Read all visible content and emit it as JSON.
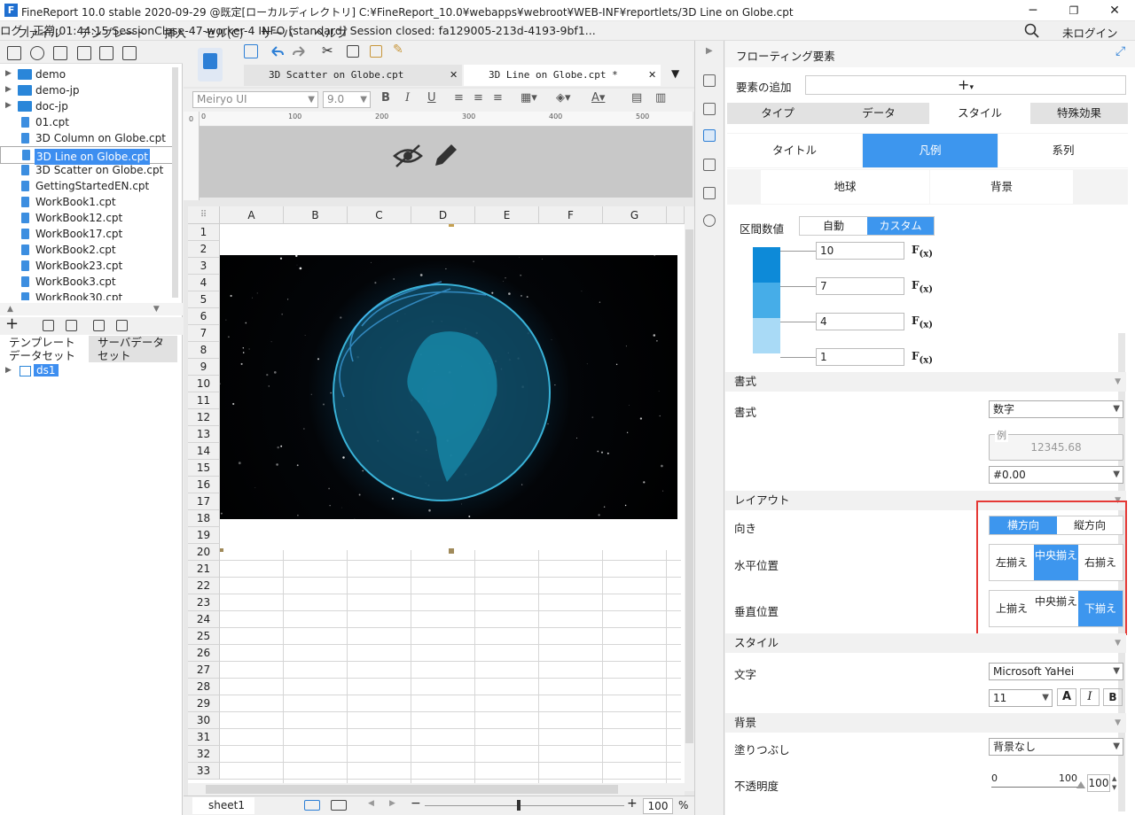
{
  "titlebar": {
    "logo": "F",
    "title": "FineReport 10.0 stable 2020-09-29 @既定[ローカルディレクトリ]    C:¥FineReport_10.0¥webapps¥webroot¥WEB-INF¥reportlets/3D Line on Globe.cpt",
    "minimize": "─",
    "restore": "❐",
    "close": "✕"
  },
  "menubar": {
    "items": [
      "ファイル",
      "テンプレート",
      "挿入",
      "セル(C)",
      "サーバ",
      "ヘルプ"
    ],
    "status": "ログ | 正常:01:44:15 SessionClose-47-worker-4 INFO [standard] Session closed: fa129005-213d-4193-9bf1...",
    "login": "未ログイン"
  },
  "filetree": {
    "items": [
      {
        "name": "demo",
        "kind": "folder"
      },
      {
        "name": "demo-jp",
        "kind": "folder"
      },
      {
        "name": "doc-jp",
        "kind": "folder"
      },
      {
        "name": "01.cpt",
        "kind": "file"
      },
      {
        "name": "3D Column on Globe.cpt",
        "kind": "file"
      },
      {
        "name": "3D Line on Globe.cpt",
        "kind": "file",
        "selected": true
      },
      {
        "name": "3D Scatter on Globe.cpt",
        "kind": "file"
      },
      {
        "name": "GettingStartedEN.cpt",
        "kind": "file"
      },
      {
        "name": "WorkBook1.cpt",
        "kind": "file"
      },
      {
        "name": "WorkBook12.cpt",
        "kind": "file"
      },
      {
        "name": "WorkBook17.cpt",
        "kind": "file"
      },
      {
        "name": "WorkBook2.cpt",
        "kind": "file"
      },
      {
        "name": "WorkBook23.cpt",
        "kind": "file"
      },
      {
        "name": "WorkBook3.cpt",
        "kind": "file"
      },
      {
        "name": "WorkBook30.cpt",
        "kind": "file"
      }
    ]
  },
  "dataset": {
    "tab1a": "テンプレート",
    "tab1b": "データセット",
    "tab2a": "サーバデータ",
    "tab2b": "セット",
    "ds": "ds1"
  },
  "editor": {
    "tabs": [
      "3D Scatter on Globe.cpt",
      "3D Line on Globe.cpt *"
    ],
    "font": "Meiryo UI",
    "size": "9.0",
    "ruler": [
      "0",
      "100",
      "200",
      "300",
      "400",
      "500"
    ],
    "columns": [
      "A",
      "B",
      "C",
      "D",
      "E",
      "F",
      "G"
    ],
    "rows": [
      "1",
      "2",
      "3",
      "4",
      "5",
      "6",
      "7",
      "8",
      "9",
      "10",
      "11",
      "12",
      "13",
      "14",
      "15",
      "16",
      "17",
      "18",
      "19",
      "20",
      "21",
      "22",
      "23",
      "24",
      "25",
      "26",
      "27",
      "28",
      "29",
      "30",
      "31",
      "32",
      "33"
    ],
    "sheet": "sheet1",
    "zoom": "100",
    "pct": "%"
  },
  "panel": {
    "title": "フローティング要素",
    "add_label": "要素の追加",
    "main_tabs": [
      "タイプ",
      "データ",
      "スタイル",
      "特殊効果"
    ],
    "sub_tabs": [
      "タイトル",
      "凡例",
      "系列"
    ],
    "sub_tabs2": [
      "地球",
      "背景"
    ],
    "interval_label": "区間数値",
    "interval_opts": [
      "自動",
      "カスタム"
    ],
    "ranges": [
      "10",
      "7",
      "4",
      "1"
    ],
    "range_colors": [
      "#0d8ad8",
      "#46ade8",
      "#a9daf6"
    ],
    "format_head": "書式",
    "format_label": "書式",
    "format_value": "数字",
    "example_label": "例",
    "example_value": "12345.68",
    "pattern": "#0.00",
    "layout_head": "レイアウト",
    "direction_label": "向き",
    "direction_opts": [
      "横方向",
      "縦方向"
    ],
    "halign_label": "水平位置",
    "halign_opts": [
      "左揃え",
      "中央揃え",
      "右揃え"
    ],
    "valign_label": "垂直位置",
    "valign_opts": [
      "上揃え",
      "中央揃え",
      "下揃え"
    ],
    "style_head": "スタイル",
    "text_label": "文字",
    "font": "Microsoft YaHei",
    "font_size": "11",
    "bg_head": "背景",
    "fill_label": "塗りつぶし",
    "fill_value": "背景なし",
    "opacity_label": "不透明度",
    "opacity_min": "0",
    "opacity_max": "100",
    "opacity_value": "100",
    "accent": "#3d96ee",
    "highlight": "#e53935"
  }
}
